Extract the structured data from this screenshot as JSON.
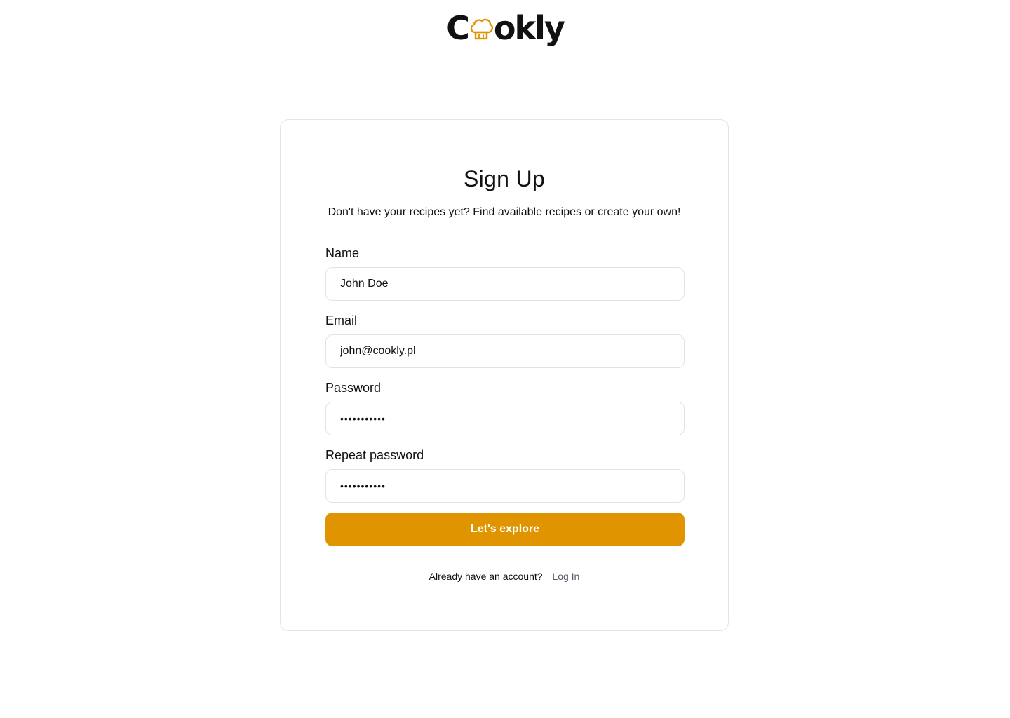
{
  "brand": {
    "logo_prefix": "C",
    "logo_suffix": "okly",
    "logo_icon": "chef-hat-icon",
    "accent_color": "#e09400"
  },
  "form": {
    "title": "Sign Up",
    "subtitle": "Don't have your recipes yet? Find available recipes or create your own!",
    "fields": [
      {
        "label": "Name",
        "value": "John Doe",
        "type": "text"
      },
      {
        "label": "Email",
        "value": "john@cookly.pl",
        "type": "email"
      },
      {
        "label": "Password",
        "value": "•••••••••••",
        "type": "password"
      },
      {
        "label": "Repeat password",
        "value": "•••••••••••",
        "type": "password"
      }
    ],
    "submit_label": "Let's explore",
    "login_prompt": "Already have an account?",
    "login_link": "Log In"
  }
}
